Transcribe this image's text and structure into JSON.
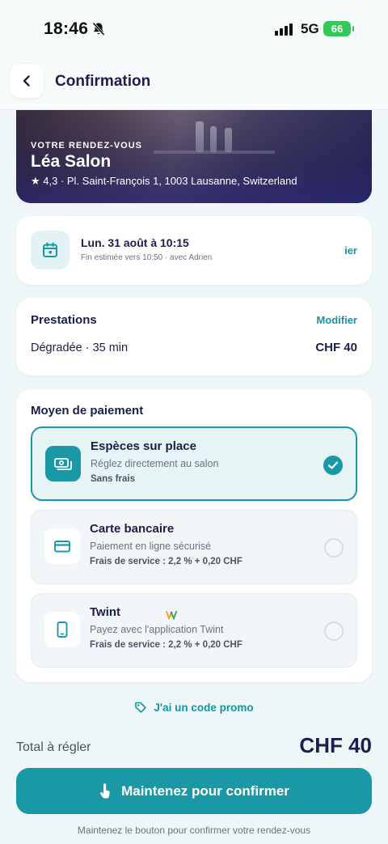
{
  "status_bar": {
    "time": "18:46",
    "network": "5G",
    "battery": "66",
    "icons": [
      "bell-slash-icon",
      "signal-icon",
      "battery-charging-icon"
    ]
  },
  "header": {
    "title": "Confirmation",
    "back_icon": "chevron-left-icon"
  },
  "salon": {
    "kicker": "VOTRE RENDEZ-VOUS",
    "name": "Léa Salon",
    "address": "★ 4,3 · Pl. Saint-François 1, 1003 Lausanne, Switzerland"
  },
  "appointment": {
    "date": "Lun. 31 août à 10:15",
    "details": "Fin estimée vers 10:50 · avec Adrien",
    "action": "ier",
    "icon": "calendar-icon"
  },
  "services": {
    "title": "Prestations",
    "modify": "Modifier",
    "items": [
      {
        "name": "Dégradée · 35 min",
        "price": "CHF 40"
      }
    ]
  },
  "payment": {
    "title": "Moyen de paiement",
    "options": [
      {
        "title": "Espèces sur place",
        "desc": "Réglez directement au salon",
        "fee": "Sans frais",
        "icon": "cash-icon",
        "selected": true
      },
      {
        "title": "Carte bancaire",
        "desc": "Paiement en ligne sécurisé",
        "fee": "Frais de service : 2,2 % + 0,20 CHF",
        "icon": "credit-card-icon",
        "selected": false
      },
      {
        "title": "Twint",
        "desc": "Payez avec l'application Twint",
        "fee": "Frais de service : 2,2 % + 0,20 CHF",
        "icon": "smartphone-icon",
        "selected": false
      }
    ]
  },
  "promo": {
    "label": "J'ai un code promo",
    "icon": "tag-icon"
  },
  "total": {
    "label": "Total à régler",
    "value": "CHF 40"
  },
  "confirm": {
    "label": "Maintenez pour confirmer",
    "hint": "Maintenez le bouton pour confirmer votre rendez-vous",
    "icon": "hand-pointer-icon"
  },
  "colors": {
    "accent": "#1a98a6",
    "text": "#1a1f4b",
    "background": "#eef6f7"
  }
}
